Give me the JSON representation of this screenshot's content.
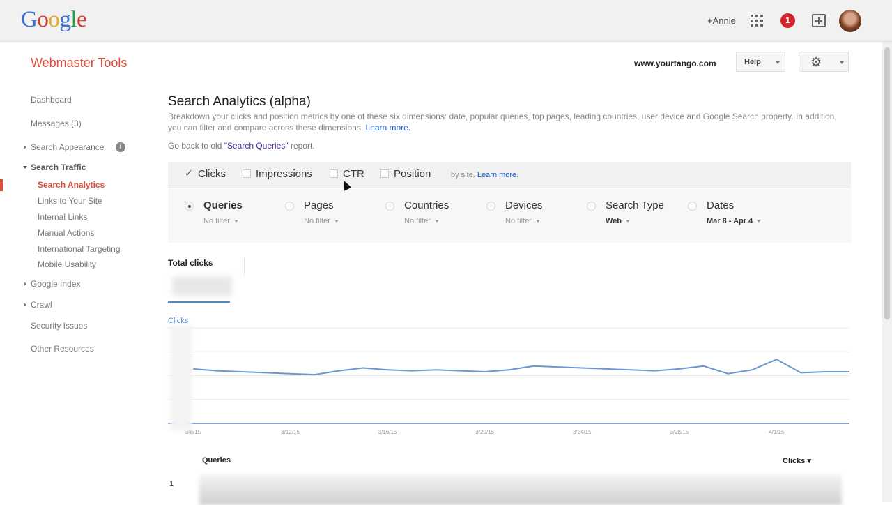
{
  "google": {
    "logo_letters": [
      "G",
      "o",
      "o",
      "g",
      "l",
      "e"
    ],
    "user_link": "+Annie",
    "notification_count": "1"
  },
  "wmt": {
    "title": "Webmaster Tools",
    "site": "www.yourtango.com",
    "help_label": "Help"
  },
  "sidebar": {
    "items": [
      {
        "label": "Dashboard"
      },
      {
        "label": "Messages (3)"
      },
      {
        "label": "Search Appearance"
      },
      {
        "label": "Search Traffic"
      },
      {
        "label": "Search Analytics"
      },
      {
        "label": "Links to Your Site"
      },
      {
        "label": "Internal Links"
      },
      {
        "label": "Manual Actions"
      },
      {
        "label": "International Targeting"
      },
      {
        "label": "Mobile Usability"
      },
      {
        "label": "Google Index"
      },
      {
        "label": "Crawl"
      },
      {
        "label": "Security Issues"
      },
      {
        "label": "Other Resources"
      }
    ]
  },
  "main": {
    "title": "Search Analytics (alpha)",
    "description": "Breakdown your clicks and position metrics by one of these six dimensions: date, popular queries, top pages, leading countries, user device and Google Search property. In addition, you can filter and compare across these dimensions.",
    "learn_more": "Learn more.",
    "back_prefix": "Go back to old ",
    "back_link": "\"Search Queries\"",
    "back_suffix": " report.",
    "metrics": [
      {
        "label": "Clicks",
        "checked": true
      },
      {
        "label": "Impressions",
        "checked": false
      },
      {
        "label": "CTR",
        "checked": false
      },
      {
        "label": "Position",
        "checked": false
      }
    ],
    "by_site": "by site.",
    "by_site_link": "Learn more.",
    "dimensions": [
      {
        "label": "Queries",
        "filter": "No filter",
        "selected": true
      },
      {
        "label": "Pages",
        "filter": "No filter"
      },
      {
        "label": "Countries",
        "filter": "No filter"
      },
      {
        "label": "Devices",
        "filter": "No filter"
      },
      {
        "label": "Search Type",
        "filter": "Web"
      },
      {
        "label": "Dates",
        "filter": "Mar 8 - Apr 4"
      }
    ],
    "total_label": "Total clicks",
    "table": {
      "col_queries": "Queries",
      "col_clicks": "Clicks ▾",
      "row_1_index": "1"
    }
  },
  "colors": {
    "accent": "#dd4b39",
    "line": "#6b96cf",
    "link": "#1a5bd6"
  },
  "chart_data": {
    "type": "line",
    "series_label": "Clicks",
    "x": [
      "3/8/15",
      "3/9/15",
      "3/10/15",
      "3/11/15",
      "3/12/15",
      "3/13/15",
      "3/14/15",
      "3/15/15",
      "3/16/15",
      "3/17/15",
      "3/18/15",
      "3/19/15",
      "3/20/15",
      "3/21/15",
      "3/22/15",
      "3/23/15",
      "3/24/15",
      "3/25/15",
      "3/26/15",
      "3/27/15",
      "3/28/15",
      "3/29/15",
      "3/30/15",
      "3/31/15",
      "4/1/15",
      "4/2/15",
      "4/3/15",
      "4/4/15"
    ],
    "x_tick_labels": [
      "3/8/15",
      "3/12/15",
      "3/16/15",
      "3/20/15",
      "3/24/15",
      "3/28/15",
      "4/1/15"
    ],
    "values": [
      57,
      55,
      54,
      53,
      52,
      51,
      55,
      58,
      56,
      55,
      56,
      55,
      54,
      56,
      60,
      59,
      58,
      57,
      56,
      55,
      57,
      60,
      52,
      56,
      67,
      53,
      54,
      54
    ],
    "ylim": [
      0,
      100
    ],
    "y_tick_labels_visible": false,
    "grid": true
  }
}
